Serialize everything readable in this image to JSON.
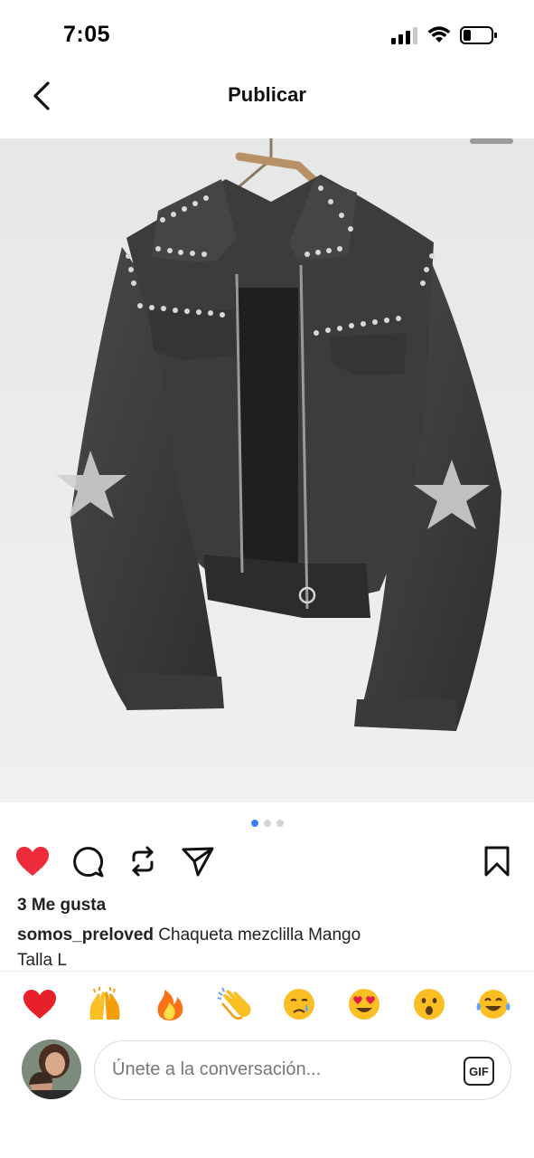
{
  "status_bar": {
    "time": "7:05"
  },
  "header": {
    "title": "Publicar"
  },
  "carousel": {
    "total": 3,
    "active_index": 0
  },
  "post": {
    "likes_text": "3 Me gusta",
    "username": "somos_preloved",
    "caption_line1": "Chaqueta mezclilla Mango",
    "caption_line2": "Talla L"
  },
  "reactions": [
    {
      "name": "red-heart-emoji"
    },
    {
      "name": "raising-hands-emoji"
    },
    {
      "name": "fire-emoji"
    },
    {
      "name": "clapping-hands-emoji"
    },
    {
      "name": "crying-face-emoji"
    },
    {
      "name": "heart-eyes-emoji"
    },
    {
      "name": "surprised-face-emoji"
    },
    {
      "name": "tears-of-joy-emoji"
    }
  ],
  "comment": {
    "placeholder": "Únete a la conversación...",
    "gif_label": "GIF"
  },
  "colors": {
    "like_red": "#ed2b3b",
    "dot_active": "#3b82f6",
    "dot_inactive": "#d4d4d4"
  }
}
